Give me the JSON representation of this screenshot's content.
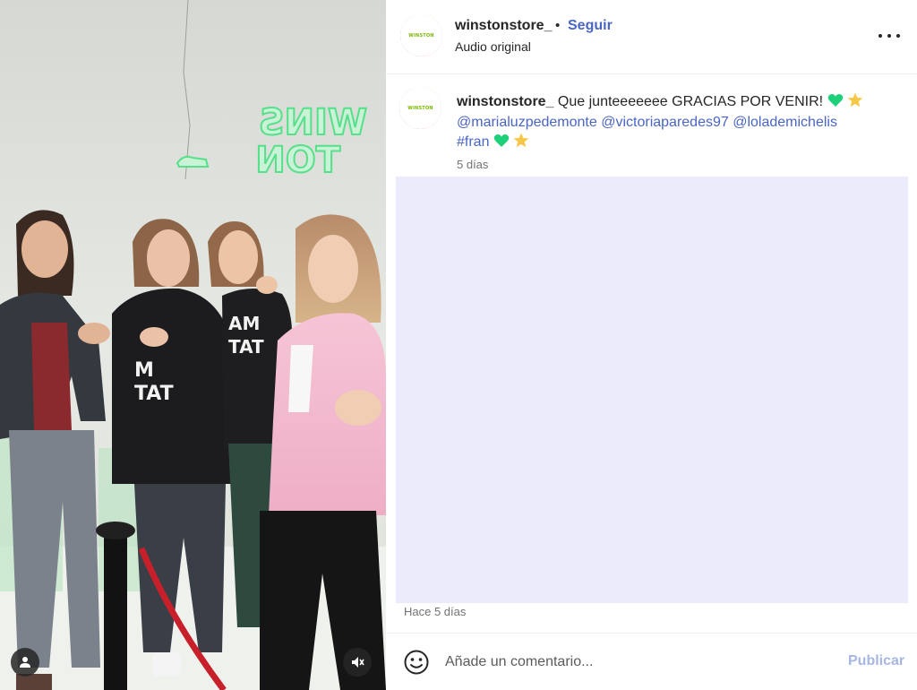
{
  "post": {
    "media": {
      "wall_sign": "WINSTON",
      "sign_color": "#55e08a",
      "user_tag_icon": "person-icon",
      "mute_icon": "speaker-muted-icon"
    },
    "header": {
      "username": "winstonstore_",
      "separator": "•",
      "follow_label": "Seguir",
      "audio_label": "Audio original",
      "more_icon": "more-horizontal-icon",
      "avatar_text": "WINSTON"
    },
    "caption": {
      "username": "winstonstore_",
      "text": "Que junteeeeeee GRACIAS POR VENIR!",
      "mentions": [
        "@marialuzpedemonte",
        "@victoriaparedes97",
        "@lolademichelis"
      ],
      "hashtag": "#fran",
      "time": "5 días",
      "emoji": [
        "green-heart",
        "star"
      ]
    },
    "comments_placeholder_color": "#ecebfc",
    "posted_ago": "Hace 5 días",
    "composer": {
      "placeholder": "Añade un comentario...",
      "publish_label": "Publicar",
      "emoji_icon": "smiley-icon"
    },
    "colors": {
      "link": "#4a66c4",
      "publish_disabled": "#a6b7e3",
      "heart": "#1fd07a",
      "star": "#f6c84a"
    }
  }
}
